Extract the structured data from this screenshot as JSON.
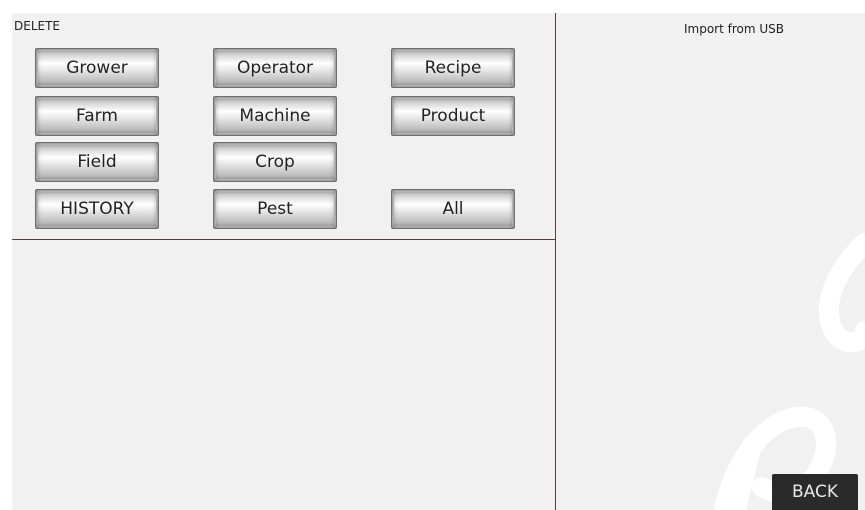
{
  "delete_panel": {
    "title": "DELETE",
    "buttons": {
      "grower": "Grower",
      "operator": "Operator",
      "recipe": "Recipe",
      "farm": "Farm",
      "machine": "Machine",
      "product": "Product",
      "field": "Field",
      "crop": "Crop",
      "history": "HISTORY",
      "pest": "Pest",
      "all": "All"
    }
  },
  "import_panel": {
    "title": "Import from USB"
  },
  "footer": {
    "back_label": "BACK"
  },
  "colors": {
    "panel_bg": "#f1f1f1",
    "divider": "#5a3d36",
    "back_bg": "#2a2a2a"
  }
}
